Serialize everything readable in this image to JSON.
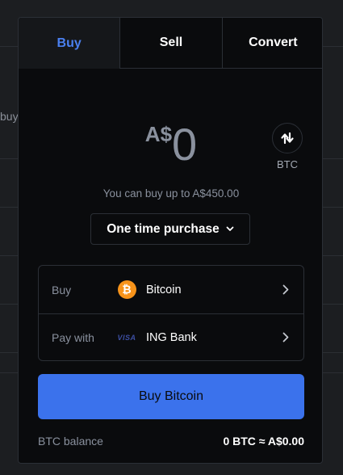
{
  "background": {
    "partial_text": "buy"
  },
  "tabs": [
    {
      "label": "Buy",
      "active": true
    },
    {
      "label": "Sell",
      "active": false
    },
    {
      "label": "Convert",
      "active": false
    }
  ],
  "amount": {
    "currency_symbol": "A$",
    "value": "0"
  },
  "switch_unit": {
    "label": "BTC",
    "icon": "arrows-swap-icon"
  },
  "limit_text": "You can buy up to A$450.00",
  "purchase_type": {
    "selected": "One time purchase",
    "icon": "chevron-down-icon"
  },
  "select_rows": [
    {
      "label": "Buy",
      "value": "Bitcoin",
      "icon": "bitcoin-icon"
    },
    {
      "label": "Pay with",
      "value": "ING Bank",
      "icon": "visa-icon",
      "icon_text": "VISA"
    }
  ],
  "primary_button": "Buy Bitcoin",
  "balance": {
    "label": "BTC balance",
    "value": "0 BTC ≈ A$0.00"
  },
  "colors": {
    "accent": "#3b72ec",
    "active_tab_text": "#4a80f0",
    "bitcoin": "#f7931a",
    "panel_bg": "#0a0b0d",
    "border": "#2b2f36"
  }
}
